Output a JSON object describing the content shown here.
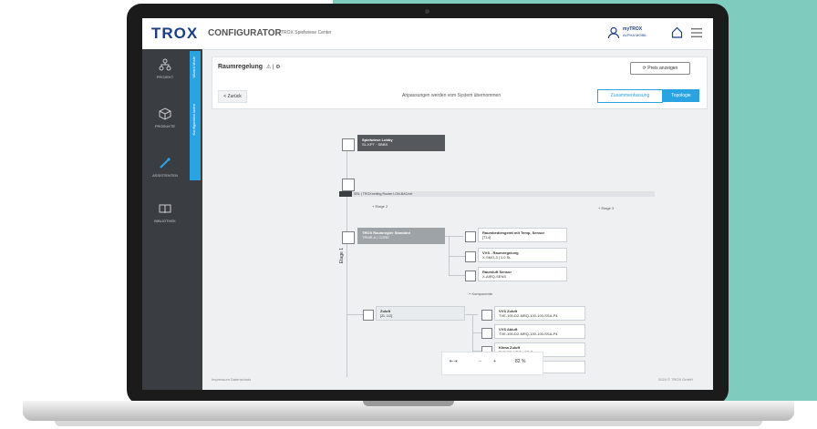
{
  "app": {
    "logo": "TROX",
    "title": "CONFIGURATOR",
    "project": "TROX Spielwiese Center"
  },
  "user": {
    "name": "myTROX",
    "org": "ALPHA MOBIL"
  },
  "sidebar": {
    "items": [
      {
        "label": "PROJEKT",
        "icon": "network-icon"
      },
      {
        "label": "PRODUKTE",
        "icon": "cube-icon"
      },
      {
        "label": "ASSISTENTEN",
        "icon": "wand-icon"
      },
      {
        "label": "BIBLIOTHEK",
        "icon": "book-icon"
      }
    ],
    "vertical_tabs": [
      "Wizard Mode",
      "Konfiguration laden"
    ]
  },
  "panel": {
    "title": "Raumregelung",
    "title_icons": "⚠ | ⚙",
    "price_button": "Preis anzeigen",
    "back_button": "< Zurück",
    "message": "Anpassungen werden vom System übernommen",
    "seg_left": "Zusammenfassung",
    "seg_right": "Topologie"
  },
  "diagram": {
    "root": {
      "title": "Spielwiese Lobby",
      "sub": "SL-KPT · SBBS"
    },
    "bus_label": "SRL | TROXnetting Router LON-BACnet",
    "add_floor_left": "+ Etage 2",
    "add_floor_right": "+ Etage 3",
    "vertical_label": "Etage 1",
    "controller": {
      "title": "TROX Raumregler Standard",
      "sub": "TRMR-6 | CORE"
    },
    "components": [
      {
        "title": "Raumbediengerät mit Temp. Sensor",
        "sub": "[T14]"
      },
      {
        "title": "VVS - Raumregelung",
        "sub": "X-SMO-3 | 1.0 SL"
      },
      {
        "title": "Raumluft Sensor",
        "sub": "X-AIRQ-SENS"
      }
    ],
    "add_component": "+ Komponente",
    "zone": {
      "title": "Zuluft",
      "sub": "[ZL 1/2]"
    },
    "zone_components": [
      {
        "title": "VVS Zuluft",
        "sub": "TVE-100-D2-MRQ-100-100-SSA-P4"
      },
      {
        "title": "VVS Abluft",
        "sub": "TVE-100-D2-MRQ-100-100-SSA-P4"
      },
      {
        "title": "Klima Zuluft",
        "sub": "TVE-D2-MRQ / ER.B"
      },
      {
        "title": "",
        "sub": ""
      }
    ]
  },
  "zoom": {
    "fit": "⇤⇥",
    "minus": "−",
    "plus": "+",
    "value": "82 %"
  },
  "footer": {
    "left": "Impressum    Datenschutz",
    "right": "2024 © TROX GmbH"
  },
  "colors": {
    "accent": "#2aa3e3",
    "brand": "#1b3f82",
    "sidebar": "#3a3d42",
    "background_teal": "#7fccbf"
  }
}
